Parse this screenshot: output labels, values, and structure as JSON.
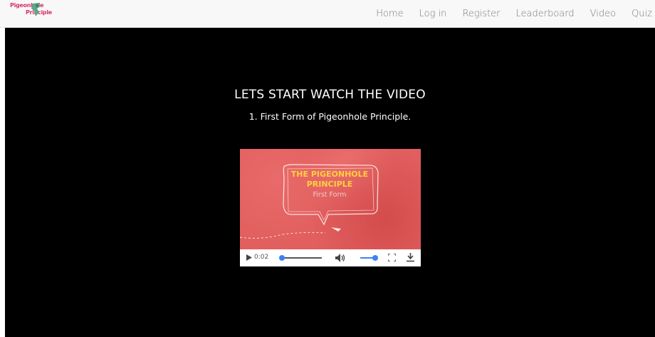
{
  "logo": {
    "line1": "Pigeonhole",
    "line2": "Principle"
  },
  "nav": {
    "items": [
      "Home",
      "Log in",
      "Register",
      "Leaderboard",
      "Video",
      "Quiz"
    ]
  },
  "main": {
    "heading": "LETS START WATCH THE VIDEO",
    "subheading": "1. First Form of Pigeonhole Principle."
  },
  "video": {
    "title_line1": "THE PIGEONHOLE",
    "title_line2": "PRINCIPLE",
    "title_line3": "First Form",
    "current_time": "0:02",
    "progress": 0.02,
    "volume": 0.85
  },
  "colors": {
    "nav_bg": "#f8f8f8",
    "nav_text": "#777777",
    "main_bg": "#000000",
    "video_bg": "#e15f5f",
    "video_title": "#ffd13a",
    "slider_accent": "#3b82f6"
  },
  "icons": [
    "play-icon",
    "volume-icon",
    "fullscreen-icon",
    "download-icon"
  ]
}
